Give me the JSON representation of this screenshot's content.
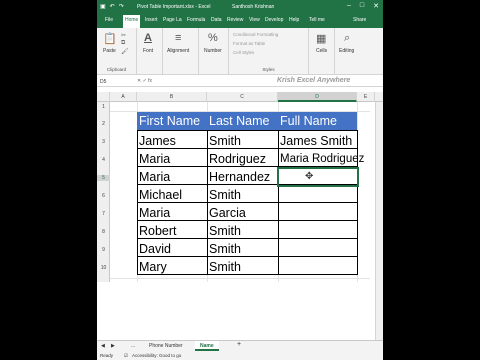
{
  "titlebar": {
    "file_title": "Pivot Table Important.xlsx  -  Excel",
    "user": "Santhosh Krishnan",
    "qat_icons": [
      "save-icon",
      "undo-icon",
      "redo-icon"
    ]
  },
  "ribbon_tabs": [
    "File",
    "Home",
    "Insert",
    "Page La",
    "Formula",
    "Data",
    "Review",
    "View",
    "Develop",
    "Help",
    "Tell me",
    "Share"
  ],
  "ribbon": {
    "paste": "Paste",
    "clipboard": "Clipboard",
    "font": "Font",
    "alignment": "Alignment",
    "number": "Number",
    "cond_format": "Conditional Formatting",
    "format_table": "Format as Table",
    "cell_styles": "Cell Styles",
    "styles": "Styles",
    "cells": "Cells",
    "editing": "Editing"
  },
  "formula_bar": {
    "name_box": "D5",
    "watermark": "Krish Excel Anywhere"
  },
  "columns": [
    "A",
    "B",
    "C",
    "D",
    "E"
  ],
  "rows": [
    "1",
    "2",
    "3",
    "4",
    "5",
    "6",
    "7",
    "8",
    "9",
    "10"
  ],
  "table": {
    "headers": [
      "First Name",
      "Last Name",
      "Full Name"
    ],
    "rows": [
      [
        "James",
        "Smith",
        "James Smith"
      ],
      [
        "Maria",
        "Rodriguez",
        "Maria Rodriguez"
      ],
      [
        "Maria",
        "Hernandez",
        ""
      ],
      [
        "Michael",
        "Smith",
        ""
      ],
      [
        "Maria",
        "Garcia",
        ""
      ],
      [
        "Robert",
        "Smith",
        ""
      ],
      [
        "David",
        "Smith",
        ""
      ],
      [
        "Mary",
        "Smith",
        ""
      ]
    ]
  },
  "sheet_tabs": {
    "ellipsis": "...",
    "tab1": "Phone Number",
    "tab2": "Name",
    "add": "+"
  },
  "statusbar": {
    "ready": "Ready",
    "accessibility": "Accessibility: Good to go"
  },
  "colors": {
    "excel_green": "#217346",
    "header_fill": "#4472c4"
  }
}
